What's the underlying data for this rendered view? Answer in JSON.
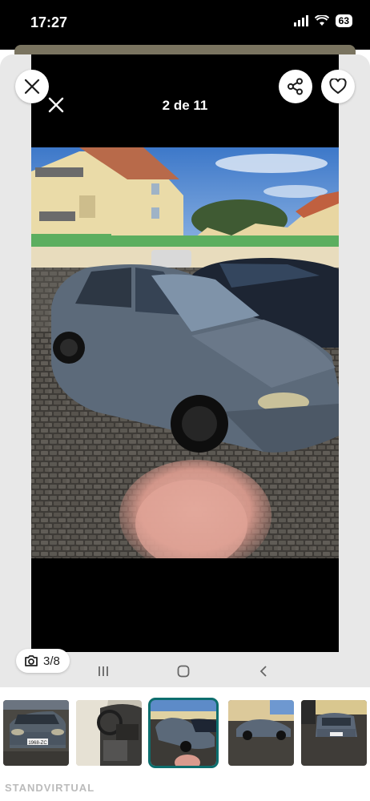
{
  "status_bar": {
    "time": "17:27",
    "battery": "63"
  },
  "header": {
    "counter": "2 de 11"
  },
  "photo_badge": {
    "label": "3/8"
  },
  "main_photo": {
    "description_icon": "car-photo"
  },
  "thumbnails": [
    {
      "id": "thumb-1",
      "plate": "1968-ZC"
    },
    {
      "id": "thumb-2"
    },
    {
      "id": "thumb-3",
      "active": true
    },
    {
      "id": "thumb-4"
    },
    {
      "id": "thumb-5"
    }
  ],
  "watermark": {
    "text": "STANDVIRTUAL"
  },
  "colors": {
    "accent": "#0d6e6e",
    "sheet": "#e8e8e8",
    "frame": "#000000"
  },
  "icons": [
    "close-icon",
    "share-icon",
    "heart-icon",
    "camera-icon",
    "recents-icon",
    "home-icon",
    "back-icon"
  ]
}
